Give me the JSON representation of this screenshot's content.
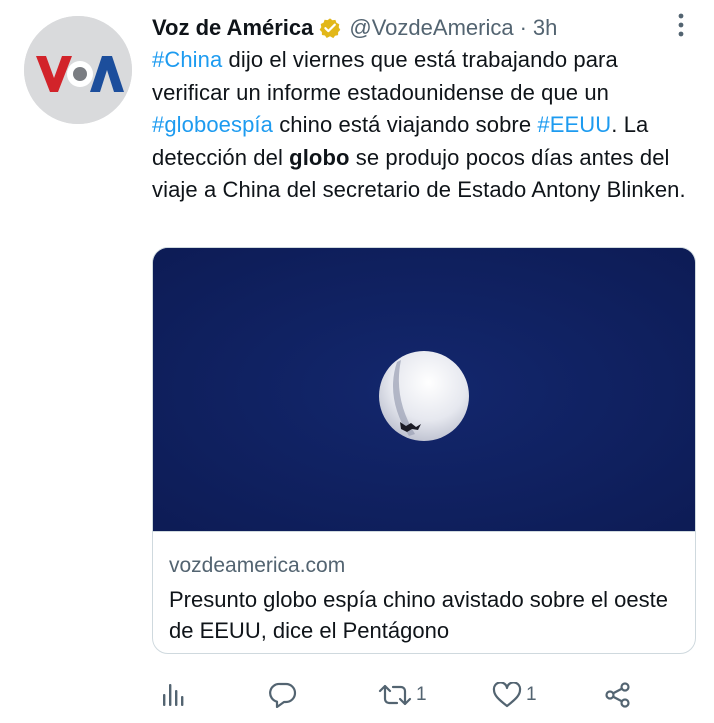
{
  "author": {
    "name": "Voz de América",
    "handle": "@VozdeAmerica",
    "separator": "·",
    "time": "3h",
    "avatar_logo_text": "VOA",
    "verified_badge_color": "#e2b719"
  },
  "tweet": {
    "segments": [
      {
        "text": "#China",
        "type": "hashtag"
      },
      {
        "text": " dijo el viernes que está trabajando para verificar un informe estadounidense de que un ",
        "type": "text"
      },
      {
        "text": "#globoespía",
        "type": "hashtag"
      },
      {
        "text": " chino está viajando sobre ",
        "type": "text"
      },
      {
        "text": "#EEUU",
        "type": "hashtag"
      },
      {
        "text": ". La detección del ",
        "type": "text"
      },
      {
        "text": "globo",
        "type": "bold"
      },
      {
        "text": " se produjo pocos días antes del viaje a China del secretario de Estado Antony Blinken.",
        "type": "text"
      }
    ]
  },
  "card": {
    "domain": "vozdeamerica.com",
    "title": "Presunto globo espía chino avistado sobre el oeste de EEUU, dice el Pentágono"
  },
  "actions": {
    "views_icon": "analytics-icon",
    "reply_icon": "reply-icon",
    "retweet_icon": "retweet-icon",
    "retweet_count": "1",
    "like_icon": "heart-icon",
    "like_count": "1",
    "share_icon": "share-icon"
  },
  "colors": {
    "hashtag": "#1d9bf0",
    "text": "#0f1419",
    "secondary": "#536471",
    "border": "#cfd9de",
    "sky": "#0f1f5c"
  }
}
